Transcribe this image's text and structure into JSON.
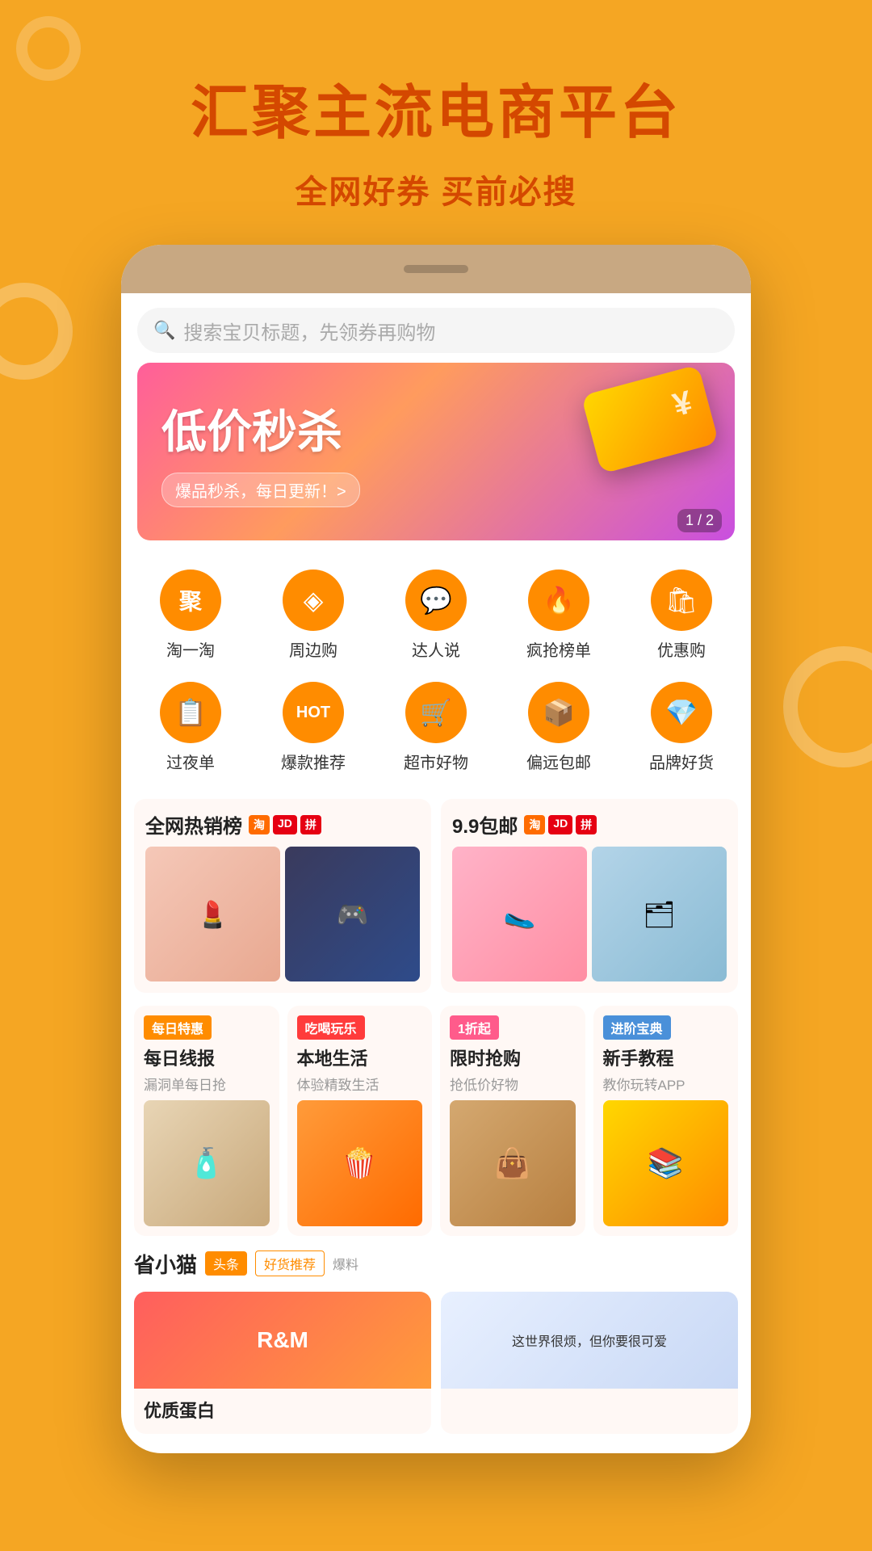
{
  "page": {
    "background_color": "#F5A623",
    "hero": {
      "title": "汇聚主流电商平台",
      "subtitle": "全网好券 买前必搜"
    },
    "search": {
      "placeholder": "搜索宝贝标题，先领券再购物"
    },
    "banner": {
      "title": "低价秒杀",
      "tag": "爆品秒杀，每日更新！>",
      "page_indicator": "1 / 2"
    },
    "categories_row1": [
      {
        "id": "tao",
        "label": "淘一淘",
        "icon": "聚"
      },
      {
        "id": "nearby",
        "label": "周边购",
        "icon": "◈"
      },
      {
        "id": "expert",
        "label": "达人说",
        "icon": "💬"
      },
      {
        "id": "rush",
        "label": "疯抢榜单",
        "icon": "🔥"
      },
      {
        "id": "deal",
        "label": "优惠购",
        "icon": "🛍"
      }
    ],
    "categories_row2": [
      {
        "id": "overnight",
        "label": "过夜单",
        "icon": "📋"
      },
      {
        "id": "hot",
        "label": "爆款推荐",
        "icon": "HOT"
      },
      {
        "id": "market",
        "label": "超市好物",
        "icon": "🛒"
      },
      {
        "id": "remote",
        "label": "偏远包邮",
        "icon": "📦"
      },
      {
        "id": "brand",
        "label": "品牌好货",
        "icon": "💎"
      }
    ],
    "hot_sections": [
      {
        "id": "bestseller",
        "title": "全网热销榜",
        "platforms": [
          "淘",
          "JD",
          "拼"
        ],
        "images": [
          "cosmetic",
          "game"
        ]
      },
      {
        "id": "99free",
        "title": "9.9包邮",
        "platforms": [
          "淘",
          "JD",
          "拼"
        ],
        "images": [
          "slipper",
          "storage"
        ]
      }
    ],
    "feature_cards": [
      {
        "id": "daily",
        "tag": "每日特惠",
        "tag_color": "orange",
        "title": "每日线报",
        "subtitle": "漏洞单每日抢",
        "img": "cream"
      },
      {
        "id": "local",
        "tag": "吃喝玩乐",
        "tag_color": "red",
        "title": "本地生活",
        "subtitle": "体验精致生活",
        "img": "popcorn"
      },
      {
        "id": "limited",
        "tag": "1折起",
        "tag_color": "pink",
        "title": "限时抢购",
        "subtitle": "抢低价好物",
        "img": "bag"
      },
      {
        "id": "tutorial",
        "tag": "进阶宝典",
        "tag_color": "blue",
        "title": "新手教程",
        "subtitle": "教你玩转APP",
        "img": "books"
      }
    ],
    "news_section": {
      "title": "省小猫",
      "tags": [
        "头条",
        "好货推荐",
        "爆料"
      ]
    },
    "bottom_products": [
      {
        "id": "protein",
        "brand": "R&M",
        "brand_sub": "",
        "name": "优质蛋白",
        "desc": "",
        "banner_type": "red"
      },
      {
        "id": "book",
        "brand": "这世界很烦，但你要很可爱",
        "brand_sub": "",
        "name": "",
        "desc": "",
        "banner_type": "blue"
      }
    ]
  }
}
